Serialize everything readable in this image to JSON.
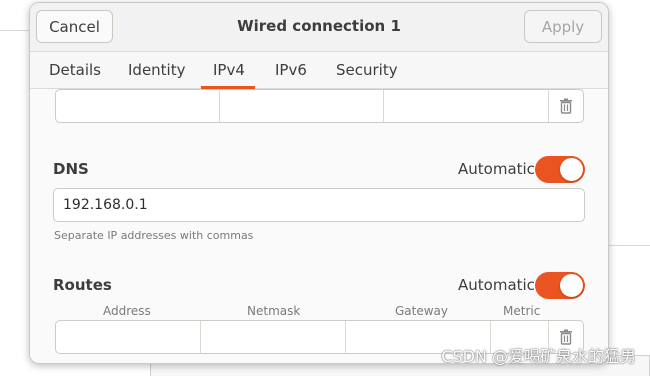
{
  "header": {
    "cancel_label": "Cancel",
    "title": "Wired connection 1",
    "apply_label": "Apply"
  },
  "tabs": [
    {
      "label": "Details"
    },
    {
      "label": "Identity"
    },
    {
      "label": "IPv4",
      "active": true
    },
    {
      "label": "IPv6"
    },
    {
      "label": "Security"
    }
  ],
  "dns": {
    "label": "DNS",
    "automatic_label": "Automatic",
    "automatic_on": true,
    "value": "192.168.0.1",
    "hint": "Separate IP addresses with commas"
  },
  "routes": {
    "label": "Routes",
    "automatic_label": "Automatic",
    "automatic_on": true,
    "columns": [
      "Address",
      "Netmask",
      "Gateway",
      "Metric"
    ]
  },
  "watermark": "CSDN @爱喝矿泉水的猛男",
  "colors": {
    "accent": "#e95420"
  },
  "icons": {
    "delete": "trash-icon"
  }
}
